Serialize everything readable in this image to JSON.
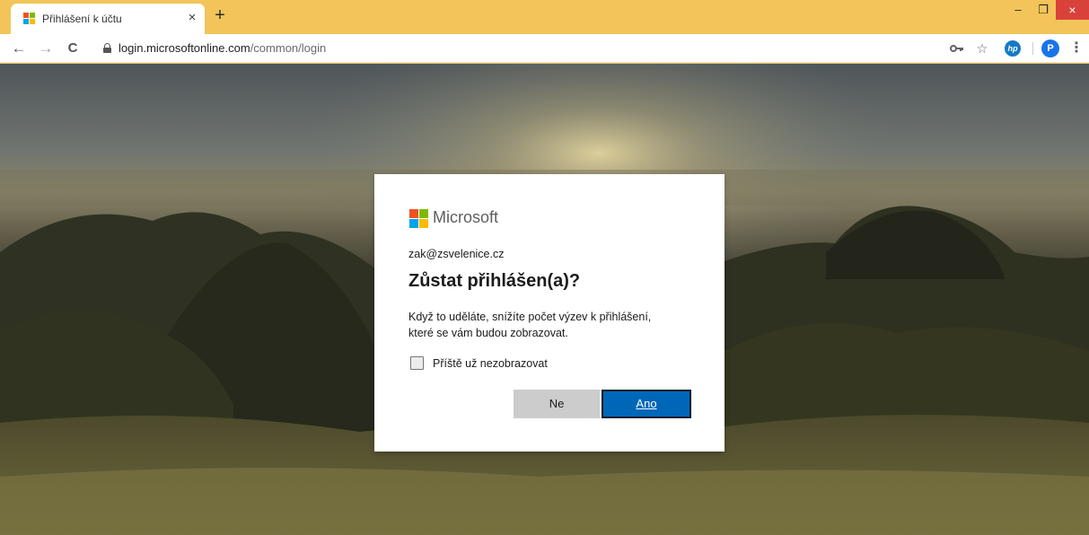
{
  "browser": {
    "tab": {
      "title": "Přihlášení k účtu",
      "close": "×"
    },
    "new_tab": "+",
    "window_controls": {
      "minimize": "–",
      "restore": "❐",
      "close": "×"
    },
    "nav": {
      "back": "←",
      "forward": "→",
      "reload": "C"
    },
    "address": {
      "host": "login.microsoftonline.com",
      "path": "/common/login"
    },
    "toolbar_icons": {
      "key": "key-icon",
      "star": "star-icon",
      "hp": "hp",
      "profile_initial": "P",
      "menu": "⋮"
    }
  },
  "dialog": {
    "brand": "Microsoft",
    "identity": "zak@zsvelenice.cz",
    "title": "Zůstat přihlášen(a)?",
    "description_line1": "Když to uděláte, snížíte počet výzev k přihlášení,",
    "description_line2": "které se vám budou zobrazovat.",
    "checkbox_label": "Příště už nezobrazovat",
    "checkbox_checked": false,
    "button_no": "Ne",
    "button_yes": "Ano"
  },
  "colors": {
    "tabstrip": "#f2c45a",
    "primary": "#0067b8",
    "ms_red": "#f25022",
    "ms_green": "#7fba00",
    "ms_blue": "#00a4ef",
    "ms_yellow": "#ffb900"
  }
}
